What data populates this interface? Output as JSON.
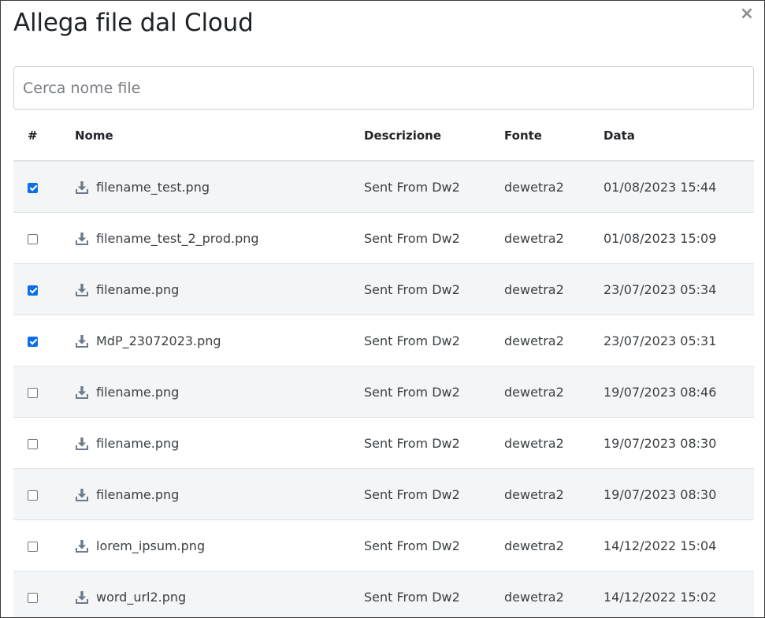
{
  "modal": {
    "title": "Allega file dal Cloud",
    "close_symbol": "×"
  },
  "search": {
    "placeholder": "Cerca nome file",
    "value": ""
  },
  "table": {
    "headers": {
      "check": "#",
      "name": "Nome",
      "description": "Descrizione",
      "source": "Fonte",
      "date": "Data"
    },
    "rows": [
      {
        "checked": true,
        "name": "filename_test.png",
        "description": "Sent From Dw2",
        "source": "dewetra2",
        "date": "01/08/2023 15:44"
      },
      {
        "checked": false,
        "name": "filename_test_2_prod.png",
        "description": "Sent From Dw2",
        "source": "dewetra2",
        "date": "01/08/2023 15:09"
      },
      {
        "checked": true,
        "name": "filename.png",
        "description": "Sent From Dw2",
        "source": "dewetra2",
        "date": "23/07/2023 05:34"
      },
      {
        "checked": true,
        "name": "MdP_23072023.png",
        "description": "Sent From Dw2",
        "source": "dewetra2",
        "date": "23/07/2023 05:31"
      },
      {
        "checked": false,
        "name": "filename.png",
        "description": "Sent From Dw2",
        "source": "dewetra2",
        "date": "19/07/2023 08:46"
      },
      {
        "checked": false,
        "name": "filename.png",
        "description": "Sent From Dw2",
        "source": "dewetra2",
        "date": "19/07/2023 08:30"
      },
      {
        "checked": false,
        "name": "filename.png",
        "description": "Sent From Dw2",
        "source": "dewetra2",
        "date": "19/07/2023 08:30"
      },
      {
        "checked": false,
        "name": "lorem_ipsum.png",
        "description": "Sent From Dw2",
        "source": "dewetra2",
        "date": "14/12/2022 15:04"
      },
      {
        "checked": false,
        "name": "word_url2.png",
        "description": "Sent From Dw2",
        "source": "dewetra2",
        "date": "14/12/2022 15:02"
      }
    ]
  },
  "icons": {
    "row_action": "download-icon",
    "close": "close-icon"
  },
  "colors": {
    "checkbox_checked": "#0b6ee8",
    "row_stripe": "#f3f5f7",
    "icon": "#6c7a8a"
  }
}
